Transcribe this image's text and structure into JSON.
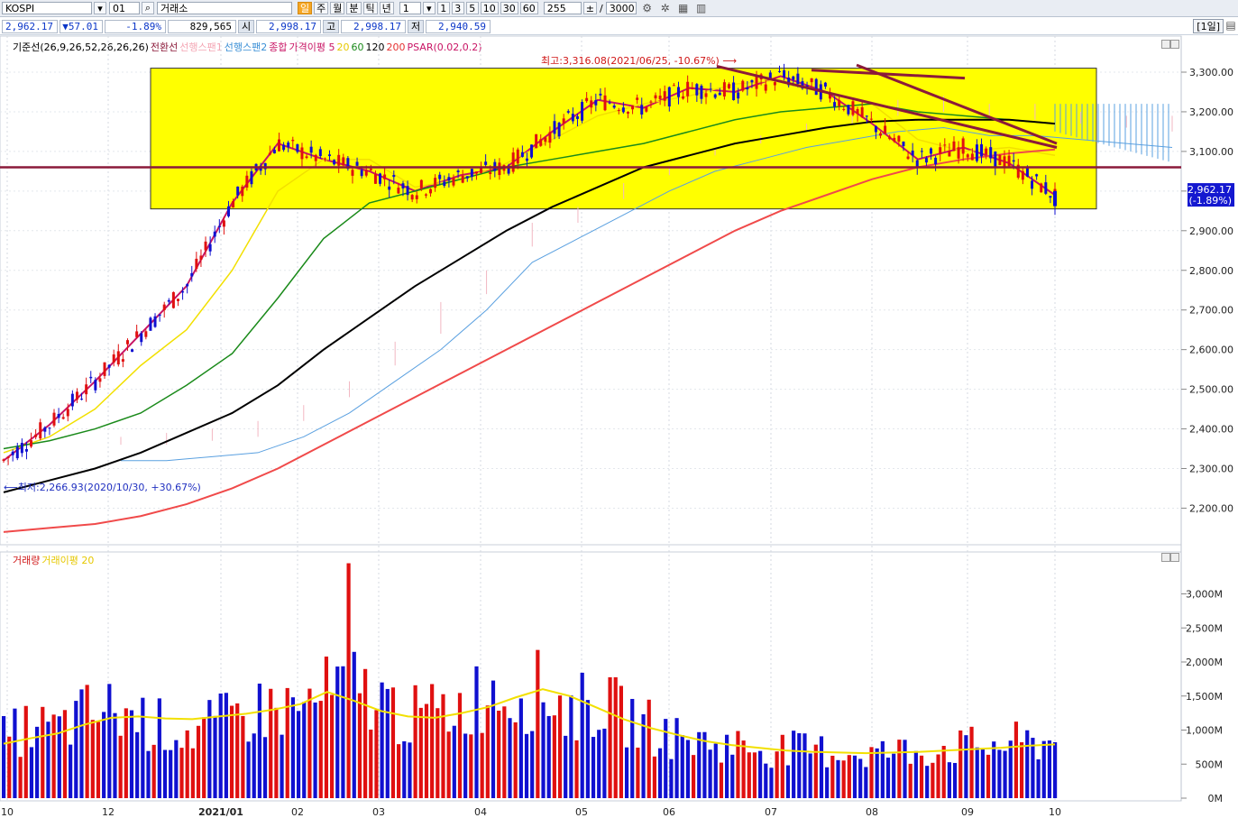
{
  "toolbar": {
    "symbol": "KOSPI",
    "code": "01",
    "market": "거래소",
    "periods": [
      "일",
      "주",
      "월",
      "분",
      "틱",
      "년"
    ],
    "active_period": "일",
    "unit": "1",
    "intervals": [
      "1",
      "3",
      "5",
      "10",
      "30",
      "60"
    ],
    "count": "255",
    "total": "3000"
  },
  "quote": {
    "price": "2,962.17",
    "change": "▼57.01",
    "change_pct": "-1.89%",
    "volume": "829,565",
    "open_label": "시",
    "open": "2,998.17",
    "high_label": "고",
    "high": "2,998.17",
    "low_label": "저",
    "low": "2,940.59",
    "period_badge": "[1일]"
  },
  "price_legend": [
    {
      "text": "기준선(26,9,26,52,26,26,26)",
      "color": "#000000"
    },
    {
      "text": "전환선",
      "color": "#8b1a3a"
    },
    {
      "text": "선행스팬1",
      "color": "#f4a6b4"
    },
    {
      "text": "선행스팬2",
      "color": "#3a8fd6"
    },
    {
      "text": "종합",
      "color": "#c81464"
    },
    {
      "text": "가격이평 5",
      "color": "#c81464"
    },
    {
      "text": "20",
      "color": "#e6c800"
    },
    {
      "text": "60",
      "color": "#1a8a1a"
    },
    {
      "text": "120",
      "color": "#000000"
    },
    {
      "text": "200",
      "color": "#e53030"
    },
    {
      "text": "PSAR(0.02,0.2)",
      "color": "#c81464"
    }
  ],
  "volume_legend": [
    {
      "text": "거래량",
      "color": "#d01818"
    },
    {
      "text": "거래이평 20",
      "color": "#e6c800"
    }
  ],
  "colors": {
    "up": "#e01010",
    "down": "#1010d0",
    "ma5": "#c81464",
    "ma20": "#f2e000",
    "ma60": "#1a8a1a",
    "ma120": "#000000",
    "ma200": "#f04a4a",
    "box": "#ffff00",
    "resistance": "#8b1a3a"
  },
  "chart_data": [
    {
      "type": "line",
      "title": "KOSPI",
      "x": [
        "2020-10",
        "2020-12",
        "2021-01",
        "2021-02",
        "2021-03",
        "2021-04",
        "2021-05",
        "2021-06",
        "2021-07",
        "2021-08",
        "2021-09",
        "2021-10"
      ],
      "x_tick_labels": [
        "10",
        "12",
        "2021/01",
        "02",
        "03",
        "04",
        "05",
        "06",
        "07",
        "08",
        "09",
        "10"
      ],
      "y_tick_labels": [
        "3,300.00",
        "3,200.00",
        "3,100.00",
        "3,000.00",
        "2,900.00",
        "2,800.00",
        "2,700.00",
        "2,600.00",
        "2,500.00",
        "2,400.00",
        "2,300.00",
        "2,200.00"
      ],
      "ylim": [
        2150,
        3370
      ],
      "series": [
        {
          "name": "5",
          "values": [
            2320,
            2410,
            2520,
            2640,
            2760,
            2970,
            3120,
            3080,
            3050,
            3000,
            3040,
            3060,
            3150,
            3230,
            3210,
            3260,
            3250,
            3290,
            3250,
            3170,
            3080,
            3110,
            3070,
            2990
          ]
        },
        {
          "name": "20",
          "values": [
            2340,
            2380,
            2450,
            2560,
            2650,
            2800,
            3000,
            3080,
            3080,
            3010,
            3030,
            3070,
            3130,
            3190,
            3220,
            3240,
            3270,
            3280,
            3250,
            3220,
            3130,
            3100,
            3110,
            3090
          ]
        },
        {
          "name": "60",
          "values": [
            2350,
            2370,
            2400,
            2440,
            2510,
            2590,
            2730,
            2880,
            2970,
            3000,
            3030,
            3060,
            3080,
            3100,
            3120,
            3150,
            3180,
            3200,
            3210,
            3220,
            3200,
            3190,
            3180,
            3170
          ]
        },
        {
          "name": "120",
          "values": [
            2240,
            2270,
            2300,
            2340,
            2390,
            2440,
            2510,
            2600,
            2680,
            2760,
            2830,
            2900,
            2960,
            3010,
            3060,
            3090,
            3120,
            3140,
            3160,
            3175,
            3180,
            3180,
            3180,
            3170
          ]
        },
        {
          "name": "200",
          "values": [
            2140,
            2150,
            2160,
            2180,
            2210,
            2250,
            2300,
            2360,
            2420,
            2480,
            2540,
            2600,
            2660,
            2720,
            2780,
            2840,
            2900,
            2950,
            2990,
            3030,
            3060,
            3080,
            3095,
            3105
          ]
        }
      ],
      "annotations": [
        "최고:3,316.08(2021/06/25, -10.67%)",
        "최저:2,266.93(2020/10/30, +30.67%)"
      ],
      "last_price_label": "2,962.17",
      "last_change_label": "(-1.89%)",
      "highlight_range": [
        2955,
        3310
      ],
      "horizontal_line": 3060
    },
    {
      "type": "bar",
      "title": "거래량",
      "x_tick_labels": [
        "10",
        "12",
        "2021/01",
        "02",
        "03",
        "04",
        "05",
        "06",
        "07",
        "08",
        "09",
        "10"
      ],
      "y_tick_labels": [
        "3,000M",
        "2,500M",
        "2,000M",
        "1,500M",
        "1,000M",
        "500M",
        "0M"
      ],
      "ylim": [
        0,
        3300
      ],
      "values": [
        880,
        1050,
        1000,
        1230,
        1280,
        1180,
        1030,
        960,
        1100,
        1250,
        1330,
        1300,
        1520,
        1640,
        1430,
        1170,
        1260,
        1340,
        1620,
        1540,
        1580,
        1280,
        1410,
        1220,
        1040,
        880,
        820,
        790,
        740,
        720,
        700,
        690,
        660,
        680,
        700,
        740,
        760,
        790,
        820,
        830
      ],
      "series": [
        {
          "name": "20",
          "values": [
            800,
            880,
            950,
            1080,
            1180,
            1200,
            1170,
            1160,
            1200,
            1240,
            1300,
            1380,
            1560,
            1430,
            1280,
            1200,
            1180,
            1250,
            1340,
            1480,
            1600,
            1500,
            1330,
            1160,
            1030,
            930,
            840,
            780,
            740,
            700,
            680,
            670,
            660,
            670,
            680,
            700,
            720,
            740,
            770,
            790
          ]
        }
      ]
    }
  ]
}
